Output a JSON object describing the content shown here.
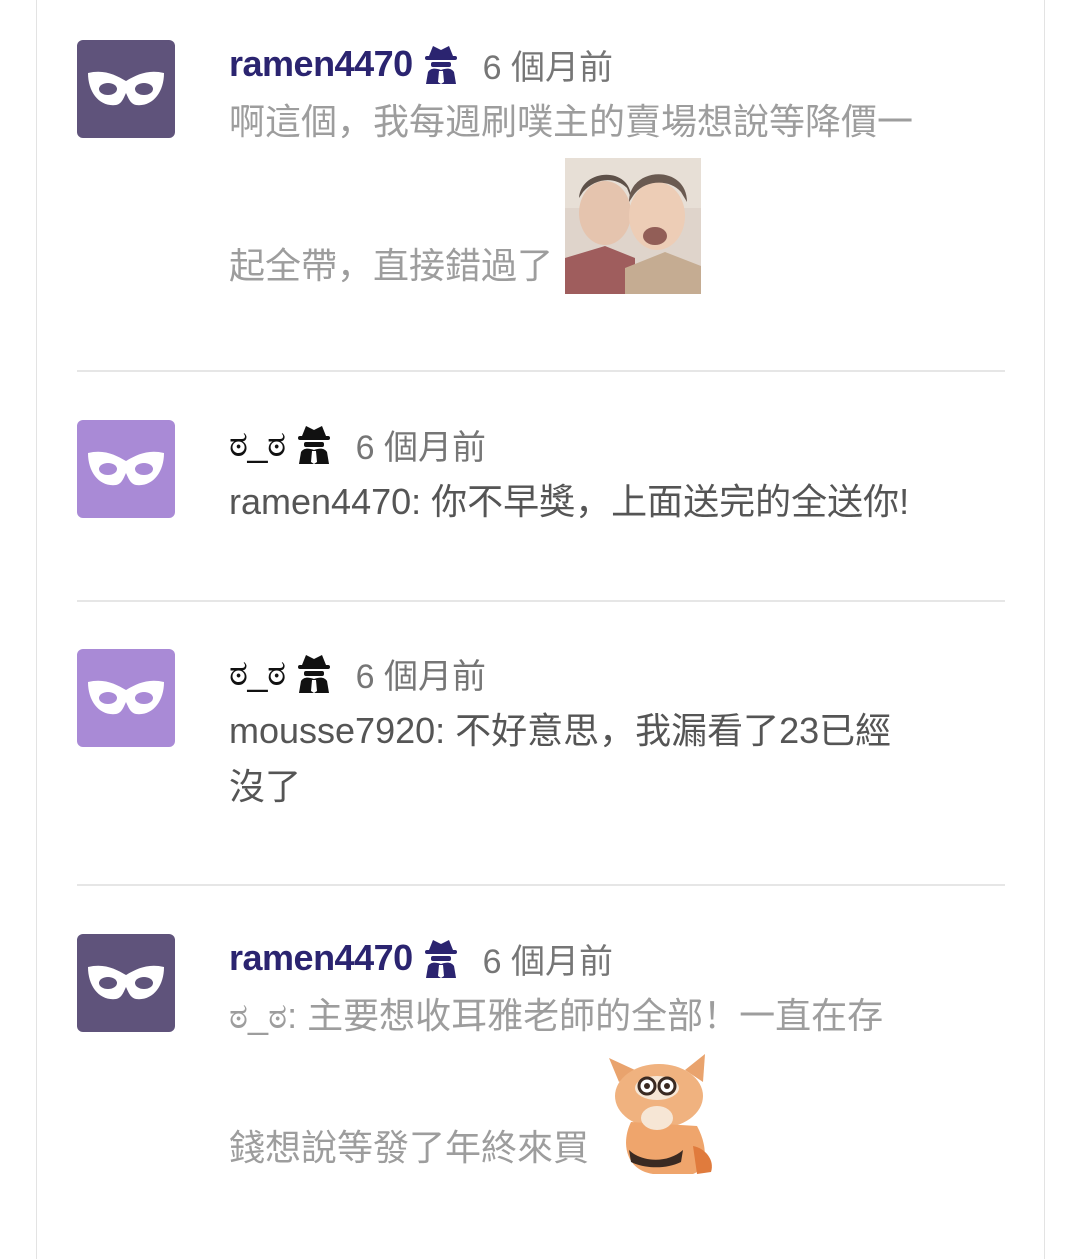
{
  "comments": [
    {
      "username": "ramen4470",
      "time": "6 個月前",
      "line1": "啊這個，我每週刷噗主的賣場想說等降價一",
      "line2": "起全帶，直接錯過了",
      "sticker": "laughing-men-sticker"
    },
    {
      "username": "ಠ_ಠ",
      "time": "6 個月前",
      "line1": "ramen4470: 你不早獎，上面送完的全送你!"
    },
    {
      "username": "ಠ_ಠ",
      "time": "6 個月前",
      "line1": "mousse7920: 不好意思，我漏看了23已經",
      "line2": "沒了"
    },
    {
      "username": "ramen4470",
      "time": "6 個月前",
      "line1": "ಠ_ಠ: 主要想收耳雅老師的全部！一直在存",
      "line2": "錢想說等發了年終來買",
      "sticker": "fox-sticker"
    }
  ],
  "colors": {
    "avatar_dark": "#5f537b",
    "avatar_light": "#a98ad6",
    "username": "#2b2470",
    "faded_text": "#9d9d9d"
  },
  "icons": {
    "avatar": "mask-icon",
    "badge": "anonymous-spy-icon"
  }
}
